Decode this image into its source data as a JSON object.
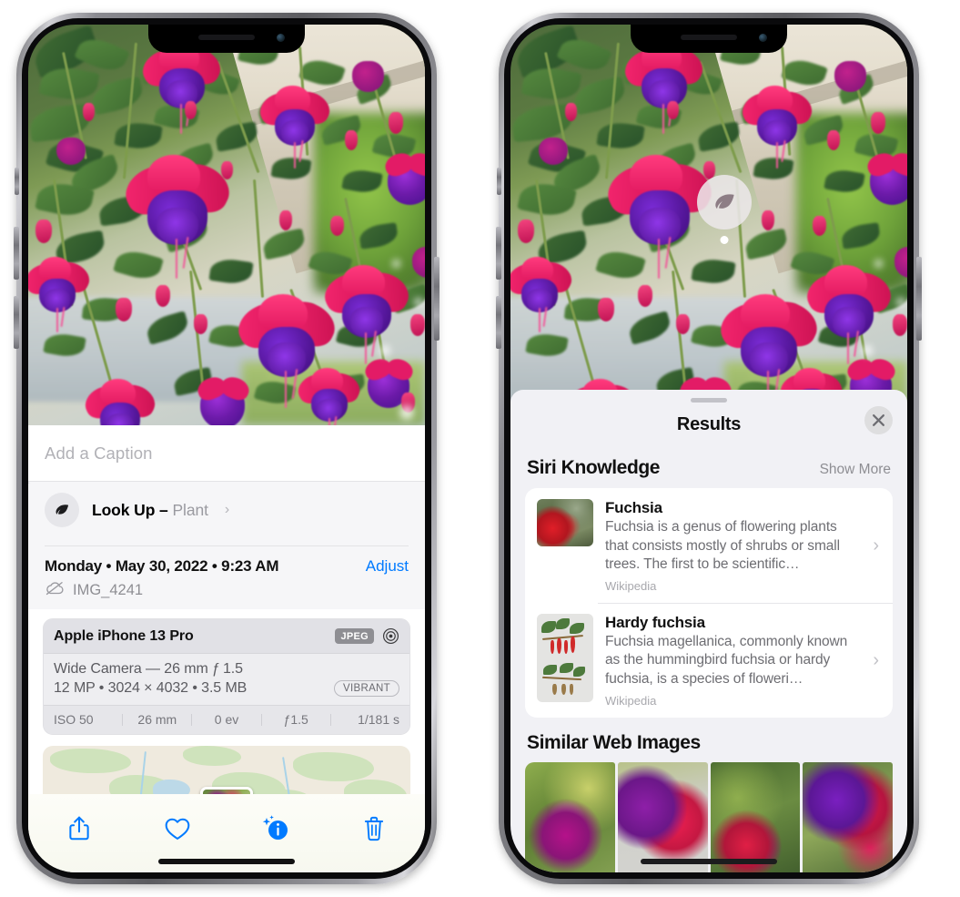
{
  "left_phone": {
    "caption_placeholder": "Add a Caption",
    "lookup": {
      "label": "Look Up – ",
      "subject": "Plant",
      "chevron": "›",
      "icon": "leaf-icon"
    },
    "meta": {
      "date": "Monday • May 30, 2022 • 9:23 AM",
      "adjust_label": "Adjust",
      "filename": "IMG_4241",
      "cloud_icon": "icloud-slash-icon"
    },
    "camera_card": {
      "device": "Apple iPhone 13 Pro",
      "format_badge": "JPEG",
      "aperture_icon": "aperture-icon",
      "lens": "Wide Camera — 26 mm ƒ 1.5",
      "specs": "12 MP • 3024 × 4032 • 3.5 MB",
      "style_badge": "VIBRANT",
      "exif": [
        "ISO 50",
        "26 mm",
        "0 ev",
        "ƒ1.5",
        "1/181 s"
      ]
    },
    "toolbar": [
      {
        "name": "share-button",
        "icon": "share-icon"
      },
      {
        "name": "favorite-button",
        "icon": "heart-icon"
      },
      {
        "name": "info-button",
        "icon": "info-sparkle-icon"
      },
      {
        "name": "delete-button",
        "icon": "trash-icon"
      }
    ]
  },
  "right_phone": {
    "visual_lookup_badge": "leaf-icon",
    "results": {
      "title": "Results",
      "close_icon": "close-icon",
      "siri_knowledge": {
        "heading": "Siri Knowledge",
        "show_more": "Show More",
        "cards": [
          {
            "title": "Fuchsia",
            "description": "Fuchsia is a genus of flowering plants that consists mostly of shrubs or small trees. The first to be scientific…",
            "source": "Wikipedia",
            "chevron": "›"
          },
          {
            "title": "Hardy fuchsia",
            "description": "Fuchsia magellanica, commonly known as the hummingbird fuchsia or hardy fuchsia, is a species of floweri…",
            "source": "Wikipedia",
            "chevron": "›"
          }
        ]
      },
      "similar_web_images": {
        "heading": "Similar Web Images",
        "count": 4
      }
    }
  },
  "colors": {
    "accent_blue": "#007aff",
    "sheet_gray": "#f1f1f5",
    "card_white": "#ffffff",
    "secondary_text": "#8e8e93"
  }
}
